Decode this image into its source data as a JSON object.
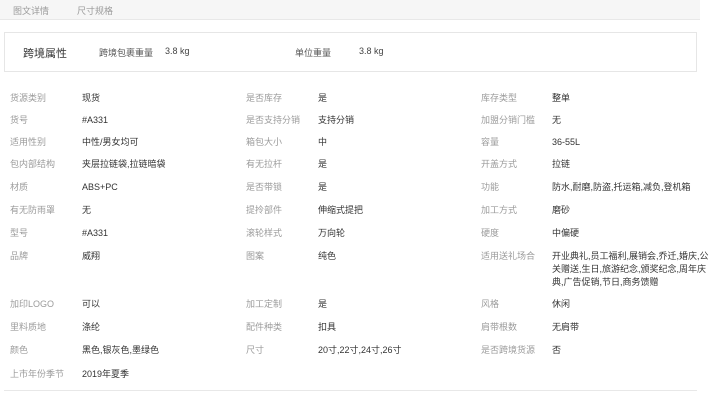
{
  "tabs": [
    "图文详情",
    "尺寸规格"
  ],
  "cross_border": {
    "title": "跨境属性",
    "package_weight_label": "跨境包裹重量",
    "package_weight_value": "3.8 kg",
    "unit_weight_label": "单位重量",
    "unit_weight_value": "3.8 kg"
  },
  "attributes": [
    {
      "label": "货源类别",
      "value": "现货"
    },
    {
      "label": "是否库存",
      "value": "是"
    },
    {
      "label": "库存类型",
      "value": "整单"
    },
    {
      "label": "货号",
      "value": "#A331"
    },
    {
      "label": "是否支持分销",
      "value": "支持分销"
    },
    {
      "label": "加盟分销门槛",
      "value": "无"
    },
    {
      "label": "适用性别",
      "value": "中性/男女均可"
    },
    {
      "label": "箱包大小",
      "value": "中"
    },
    {
      "label": "容量",
      "value": "36-55L"
    },
    {
      "label": "包内部结构",
      "value": "夹层拉链袋,拉链暗袋"
    },
    {
      "label": "有无拉杆",
      "value": "是"
    },
    {
      "label": "开盖方式",
      "value": "拉链"
    },
    {
      "label": "材质",
      "value": "ABS+PC"
    },
    {
      "label": "是否带锁",
      "value": "是"
    },
    {
      "label": "功能",
      "value": "防水,耐磨,防盗,托运箱,减负,登机箱"
    },
    {
      "label": "有无防雨罩",
      "value": "无"
    },
    {
      "label": "提拎部件",
      "value": "伸缩式提把"
    },
    {
      "label": "加工方式",
      "value": "磨砂"
    },
    {
      "label": "型号",
      "value": "#A331"
    },
    {
      "label": "滚轮样式",
      "value": "万向轮"
    },
    {
      "label": "硬度",
      "value": "中偏硬"
    },
    {
      "label": "品牌",
      "value": "威翔"
    },
    {
      "label": "图案",
      "value": "纯色"
    },
    {
      "label": "适用送礼场合",
      "value": "开业典礼,员工福利,展销会,乔迁,婚庆,公关赠送,生日,旅游纪念,颁奖纪念,周年庆典,广告促销,节日,商务馈赠"
    },
    {
      "label": "加印LOGO",
      "value": "可以"
    },
    {
      "label": "加工定制",
      "value": "是"
    },
    {
      "label": "风格",
      "value": "休闲"
    },
    {
      "label": "里料质地",
      "value": "涤纶"
    },
    {
      "label": "配件种类",
      "value": "扣具"
    },
    {
      "label": "肩带根数",
      "value": "无肩带"
    },
    {
      "label": "颜色",
      "value": "黑色,银灰色,墨绿色"
    },
    {
      "label": "尺寸",
      "value": "20寸,22寸,24寸,26寸"
    },
    {
      "label": "是否跨境货源",
      "value": "否"
    },
    {
      "label": "上市年份季节",
      "value": "2019年夏季"
    }
  ]
}
